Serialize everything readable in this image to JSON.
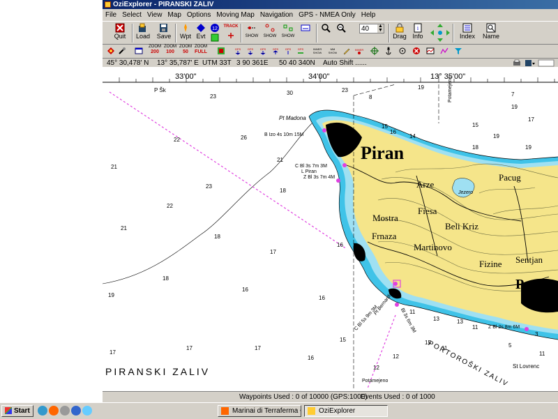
{
  "window": {
    "title": "OziExplorer - PIRANSKI ZALIV"
  },
  "menu": [
    "File",
    "Select",
    "View",
    "Map",
    "Options",
    "Moving Map",
    "Navigation",
    "GPS - NMEA Only",
    "Help"
  ],
  "toolbar": {
    "quit": "Quit",
    "load": "Load",
    "save": "Save",
    "wpt": "Wpt",
    "evt": "Evt",
    "track": "TRACK",
    "show1": "SHOW",
    "show2": "SHOW",
    "show3": "SHOW",
    "zoom_value": "40",
    "drag": "Drag",
    "info": "Info",
    "index": "Index",
    "name": "Name"
  },
  "zoom_buttons": [
    {
      "top": "ZOOM",
      "bottom": "200"
    },
    {
      "top": "ZOOM",
      "bottom": "100"
    },
    {
      "top": "ZOOM",
      "bottom": "50"
    },
    {
      "top": "ZOOM",
      "bottom": "FULL"
    }
  ],
  "status": {
    "lat": "45° 30,478' N",
    "lon": "13° 35,787' E",
    "utm": "UTM  33T",
    "easting": "3 90 361E",
    "northing": "50 40 340N",
    "autoshift": "Auto Shift ......"
  },
  "map": {
    "ruler_labels": [
      "33'00\"",
      "34'00\"",
      "13° 35'00\""
    ],
    "place_names": {
      "piran": "Piran",
      "arze": "Arze",
      "fiesa": "Fiesa",
      "mostra": "Mostra",
      "frnaza": "Frnaza",
      "beli_kriz": "Beli Kriz",
      "martinovo": "Martinovo",
      "fizine": "Fizine",
      "sentjan": "Sentjan",
      "pacug": "Pacug",
      "portoroz": "Portoro",
      "piranski_zaliv": "PIRANSKI  ZALIV",
      "portoroski_zaliv": "PORTOROŠKI ZALIV",
      "pt_madona": "Pt Madona",
      "pt_bernardin": "Pt Bernardin",
      "jezero": "Jezero",
      "potamejeno1": "Potamejeno",
      "potamejeno2": "Potamejeno",
      "st_lovrenc": "St Lovrenc",
      "p_sk": "P Šk",
      "l_piran": "L Piran"
    },
    "light_labels": [
      "B Izo 4s 10m 15M",
      "C Bl 3s 7m 3M",
      "Z Bl 3s 7m 4M",
      "C Bl 5s 9m 3M",
      "Bl 3s 6m 3M",
      "Z Bl 2s 8m 6M"
    ],
    "depths": [
      "23",
      "30",
      "23",
      "26",
      "22",
      "21",
      "21",
      "23",
      "18",
      "22",
      "21",
      "18",
      "17",
      "18",
      "19",
      "16",
      "16",
      "16",
      "17",
      "17",
      "16",
      "17",
      "15",
      "16",
      "14",
      "12",
      "11",
      "13",
      "15",
      "15",
      "12",
      "8",
      "7",
      "19",
      "19",
      "17",
      "18",
      "19",
      "19",
      "15",
      "11",
      "5",
      "3",
      "11",
      "13",
      "11"
    ]
  },
  "bottom": {
    "waypoints": "Waypoints Used : 0 of 10000  (GPS:1000)",
    "events": "Events Used : 0 of 1000"
  },
  "taskbar": {
    "start": "Start",
    "task1": "Marinai di Terraferma • L...",
    "task2": "OziExplorer"
  }
}
